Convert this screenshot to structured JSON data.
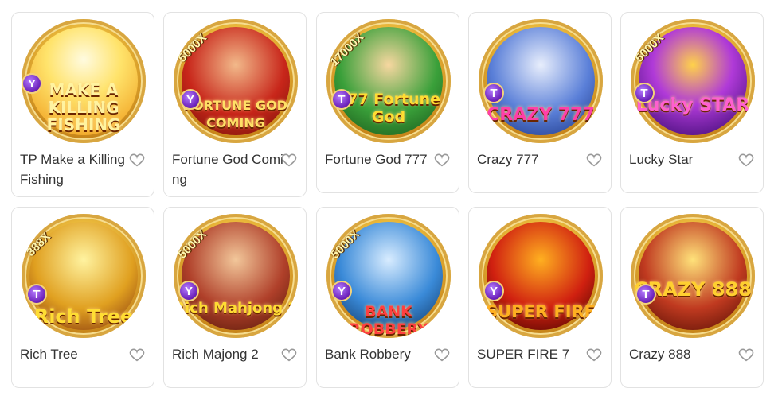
{
  "games": [
    {
      "title": "TP Make a Killing Fishing",
      "logo": "MAKE A KILLING FISHING",
      "logo_color": "#fff3a0",
      "bg": "#ffd84a",
      "multiplier": ""
    },
    {
      "title": "Fortune God Coming",
      "logo": "FORTUNE GOD COMING",
      "logo_color": "#ffe066",
      "bg": "#c8261a",
      "multiplier": "5000X"
    },
    {
      "title": "Fortune God 777",
      "logo": "777 Fortune God",
      "logo_color": "#ffdd33",
      "bg": "#3aa03a",
      "multiplier": "17000X"
    },
    {
      "title": "Crazy 777",
      "logo": "CRAZY 777",
      "logo_color": "#ff3fa8",
      "bg": "#5a7fd8",
      "multiplier": ""
    },
    {
      "title": "Lucky Star",
      "logo": "Lucky STAR",
      "logo_color": "#ff5fd0",
      "bg": "#7a1fb0",
      "multiplier": "5000X"
    },
    {
      "title": "Rich Tree",
      "logo": "Rich Tree",
      "logo_color": "#ffdd33",
      "bg": "#e0a020",
      "multiplier": "388X"
    },
    {
      "title": "Rich Majong 2",
      "logo": "Rich Mahjong 2",
      "logo_color": "#ffdd33",
      "bg": "#b0402a",
      "multiplier": "5000X"
    },
    {
      "title": "Bank Robbery",
      "logo": "BANK ROBBERY",
      "logo_color": "#ff4040",
      "bg": "#3a8ad8",
      "multiplier": "5000X"
    },
    {
      "title": "SUPER FIRE 7",
      "logo": "SUPER FIRE",
      "logo_color": "#ffb020",
      "bg": "#d02010",
      "multiplier": ""
    },
    {
      "title": "Crazy 888",
      "logo": "CRAZY 888",
      "logo_color": "#ffcf30",
      "bg": "#c03a20",
      "multiplier": ""
    }
  ],
  "badge_letter": "T",
  "badge_letter_alt": "Y"
}
